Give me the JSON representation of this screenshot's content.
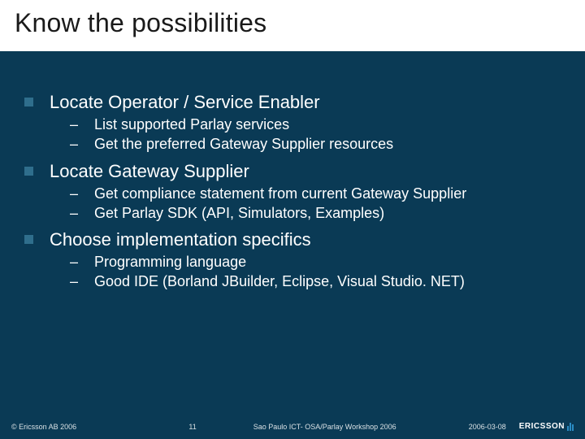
{
  "title": "Know the possibilities",
  "bullets": [
    {
      "text": "Locate Operator / Service Enabler",
      "subs": [
        "List supported Parlay services",
        "Get the preferred Gateway Supplier resources"
      ]
    },
    {
      "text": "Locate Gateway Supplier",
      "subs": [
        "Get compliance statement from current Gateway Supplier",
        "Get Parlay SDK (API, Simulators, Examples)"
      ]
    },
    {
      "text": "Choose implementation specifics",
      "subs": [
        "Programming language",
        "Good IDE (Borland JBuilder, Eclipse, Visual Studio. NET)"
      ]
    }
  ],
  "footer": {
    "copyright": "© Ericsson AB 2006",
    "page_number": "11",
    "event": "Sao Paulo ICT- OSA/Parlay Workshop 2006",
    "date": "2006-03-08",
    "logo_text": "ERICSSON"
  }
}
